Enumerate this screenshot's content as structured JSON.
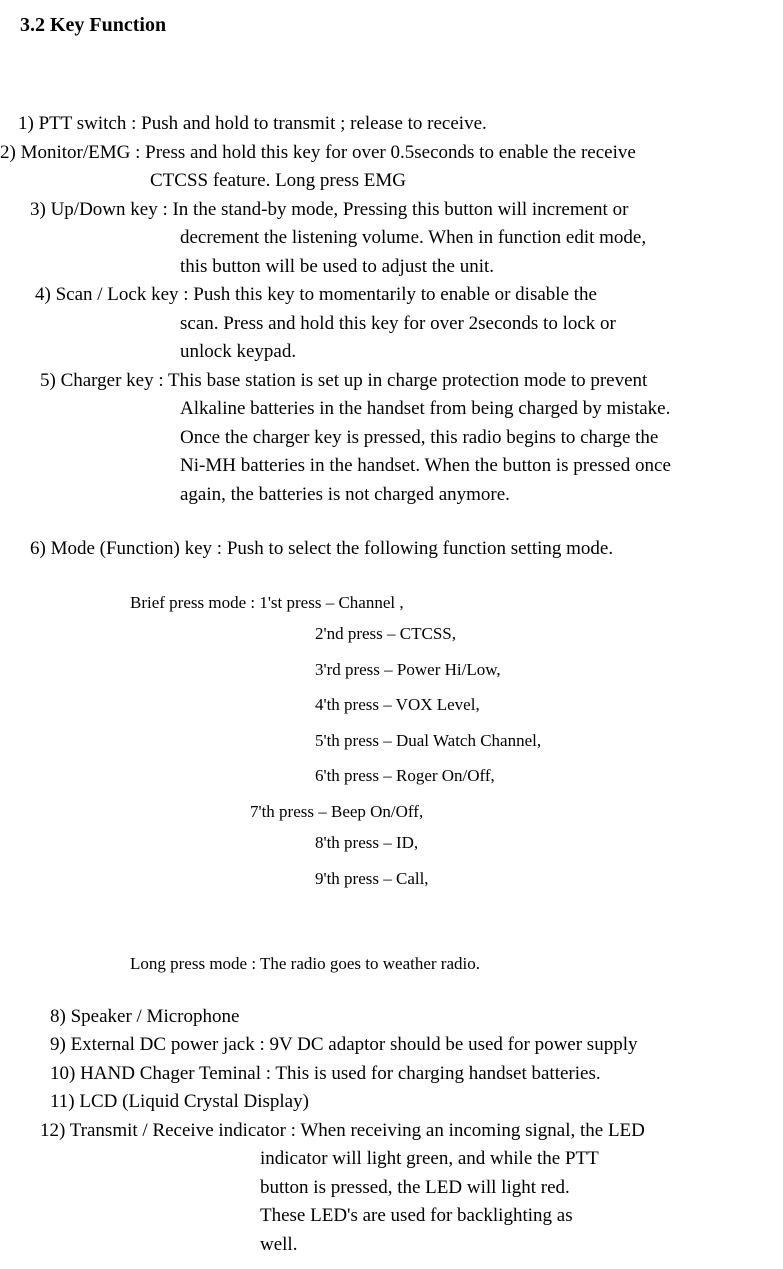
{
  "heading": "3.2 Key Function",
  "items": {
    "i1": "1) PTT switch : Push and hold to transmit ; release to receive.",
    "i2a": "2) Monitor/EMG : Press and hold this key for over 0.5seconds to enable the receive",
    "i2b": "CTCSS feature. Long press EMG",
    "i3a": "3) Up/Down key : In the stand-by mode, Pressing  this button will increment or",
    "i3b": "decrement the listening volume. When in function edit mode,",
    "i3c": "this button will be used to adjust the unit.",
    "i4a": "4) Scan / Lock key : Push this key to momentarily to enable or disable the",
    "i4b": "scan. Press and hold this key for over 2seconds to lock or",
    "i4c": "unlock keypad.",
    "i5a": "5) Charger key : This base station is set up in charge protection mode to prevent",
    "i5b": "Alkaline batteries in the handset from being charged by mistake.",
    "i5c": "Once the charger key is pressed, this radio begins to charge the",
    "i5d": "Ni-MH batteries in the handset. When the button is pressed once",
    "i5e": "again, the batteries is not charged anymore.",
    "i6": "6) Mode (Function) key : Push to select the following function setting mode.",
    "brief_label": "Brief press mode :    1'st press – Channel ,",
    "press": {
      "p2": "2'nd press – CTCSS,",
      "p3": "3'rd press – Power Hi/Low,",
      "p4": "4'th press – VOX Level,",
      "p5": "5'th press – Dual Watch Channel,",
      "p6": "6'th press – Roger On/Off,",
      "p7": "7'th press – Beep On/Off,",
      "p8": "8'th press – ID,",
      "p9": "9'th press – Call,"
    },
    "long_label": "Long press mode :  The radio goes to weather radio.",
    "i8": "8) Speaker / Microphone",
    "i9": "9) External DC power jack : 9V DC adaptor should be used for power supply",
    "i10": "10) HAND Chager Teminal : This is used for charging handset batteries.",
    "i11": "11) LCD (Liquid Crystal Display)",
    "i12a": "12) Transmit / Receive indicator : When receiving an incoming signal, the LED",
    "i12b": "indicator will light green, and while the PTT",
    "i12c": "button is pressed, the LED will light red.",
    "i12d": "These LED's are used for backlighting as",
    "i12e": "well."
  }
}
